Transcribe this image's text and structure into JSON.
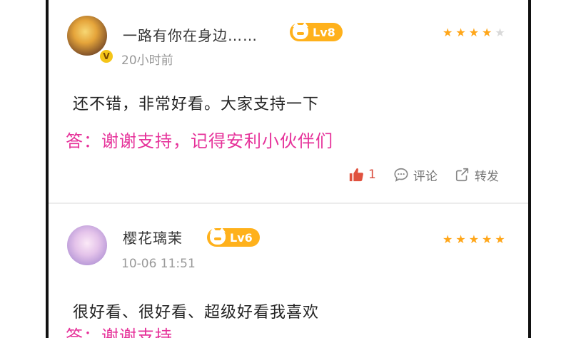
{
  "comments": [
    {
      "username": "一路有你在身边……",
      "level": "Lv8",
      "vip_badge": "V",
      "rating": 4,
      "timestamp": "20小时前",
      "text": "还不错，非常好看。大家支持一下",
      "reply": "答：谢谢支持，记得安利小伙伴们",
      "likes": "1",
      "comment_label": "评论",
      "share_label": "转发"
    },
    {
      "username": "樱花璃茉",
      "level": "Lv6",
      "rating": 5,
      "timestamp": "10-06 11:51",
      "text": "很好看、很好看、超级好看我喜欢",
      "reply": "答：谢谢支持"
    }
  ],
  "colors": {
    "accent_reply": "#e6329a",
    "star": "#ffa619",
    "level_badge": "#ffb11b",
    "like": "#d94c3d"
  }
}
